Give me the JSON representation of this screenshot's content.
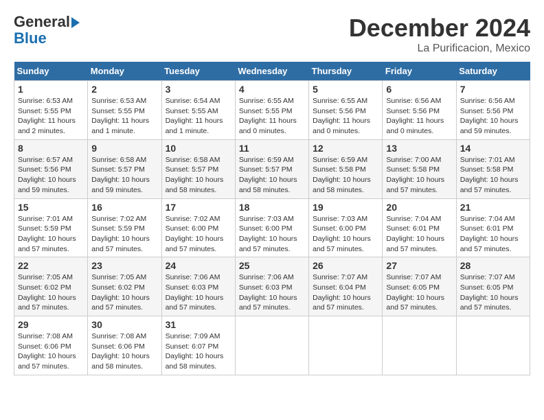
{
  "header": {
    "logo_line1": "General",
    "logo_line2": "Blue",
    "month": "December 2024",
    "location": "La Purificacion, Mexico"
  },
  "days_of_week": [
    "Sunday",
    "Monday",
    "Tuesday",
    "Wednesday",
    "Thursday",
    "Friday",
    "Saturday"
  ],
  "weeks": [
    [
      {
        "day": 1,
        "rise": "6:53 AM",
        "set": "5:55 PM",
        "daylight": "11 hours and 2 minutes."
      },
      {
        "day": 2,
        "rise": "6:53 AM",
        "set": "5:55 PM",
        "daylight": "11 hours and 1 minute."
      },
      {
        "day": 3,
        "rise": "6:54 AM",
        "set": "5:55 AM",
        "daylight": "11 hours and 1 minute."
      },
      {
        "day": 4,
        "rise": "6:55 AM",
        "set": "5:55 PM",
        "daylight": "11 hours and 0 minutes."
      },
      {
        "day": 5,
        "rise": "6:55 AM",
        "set": "5:56 PM",
        "daylight": "11 hours and 0 minutes."
      },
      {
        "day": 6,
        "rise": "6:56 AM",
        "set": "5:56 PM",
        "daylight": "11 hours and 0 minutes."
      },
      {
        "day": 7,
        "rise": "6:56 AM",
        "set": "5:56 PM",
        "daylight": "10 hours and 59 minutes."
      }
    ],
    [
      {
        "day": 8,
        "rise": "6:57 AM",
        "set": "5:56 PM",
        "daylight": "10 hours and 59 minutes."
      },
      {
        "day": 9,
        "rise": "6:58 AM",
        "set": "5:57 PM",
        "daylight": "10 hours and 59 minutes."
      },
      {
        "day": 10,
        "rise": "6:58 AM",
        "set": "5:57 PM",
        "daylight": "10 hours and 58 minutes."
      },
      {
        "day": 11,
        "rise": "6:59 AM",
        "set": "5:57 PM",
        "daylight": "10 hours and 58 minutes."
      },
      {
        "day": 12,
        "rise": "6:59 AM",
        "set": "5:58 PM",
        "daylight": "10 hours and 58 minutes."
      },
      {
        "day": 13,
        "rise": "7:00 AM",
        "set": "5:58 PM",
        "daylight": "10 hours and 57 minutes."
      },
      {
        "day": 14,
        "rise": "7:01 AM",
        "set": "5:58 PM",
        "daylight": "10 hours and 57 minutes."
      }
    ],
    [
      {
        "day": 15,
        "rise": "7:01 AM",
        "set": "5:59 PM",
        "daylight": "10 hours and 57 minutes."
      },
      {
        "day": 16,
        "rise": "7:02 AM",
        "set": "5:59 PM",
        "daylight": "10 hours and 57 minutes."
      },
      {
        "day": 17,
        "rise": "7:02 AM",
        "set": "6:00 PM",
        "daylight": "10 hours and 57 minutes."
      },
      {
        "day": 18,
        "rise": "7:03 AM",
        "set": "6:00 PM",
        "daylight": "10 hours and 57 minutes."
      },
      {
        "day": 19,
        "rise": "7:03 AM",
        "set": "6:00 PM",
        "daylight": "10 hours and 57 minutes."
      },
      {
        "day": 20,
        "rise": "7:04 AM",
        "set": "6:01 PM",
        "daylight": "10 hours and 57 minutes."
      },
      {
        "day": 21,
        "rise": "7:04 AM",
        "set": "6:01 PM",
        "daylight": "10 hours and 57 minutes."
      }
    ],
    [
      {
        "day": 22,
        "rise": "7:05 AM",
        "set": "6:02 PM",
        "daylight": "10 hours and 57 minutes."
      },
      {
        "day": 23,
        "rise": "7:05 AM",
        "set": "6:02 PM",
        "daylight": "10 hours and 57 minutes."
      },
      {
        "day": 24,
        "rise": "7:06 AM",
        "set": "6:03 PM",
        "daylight": "10 hours and 57 minutes."
      },
      {
        "day": 25,
        "rise": "7:06 AM",
        "set": "6:03 PM",
        "daylight": "10 hours and 57 minutes."
      },
      {
        "day": 26,
        "rise": "7:07 AM",
        "set": "6:04 PM",
        "daylight": "10 hours and 57 minutes."
      },
      {
        "day": 27,
        "rise": "7:07 AM",
        "set": "6:05 PM",
        "daylight": "10 hours and 57 minutes."
      },
      {
        "day": 28,
        "rise": "7:07 AM",
        "set": "6:05 PM",
        "daylight": "10 hours and 57 minutes."
      }
    ],
    [
      {
        "day": 29,
        "rise": "7:08 AM",
        "set": "6:06 PM",
        "daylight": "10 hours and 57 minutes."
      },
      {
        "day": 30,
        "rise": "7:08 AM",
        "set": "6:06 PM",
        "daylight": "10 hours and 58 minutes."
      },
      {
        "day": 31,
        "rise": "7:09 AM",
        "set": "6:07 PM",
        "daylight": "10 hours and 58 minutes."
      },
      null,
      null,
      null,
      null
    ]
  ]
}
